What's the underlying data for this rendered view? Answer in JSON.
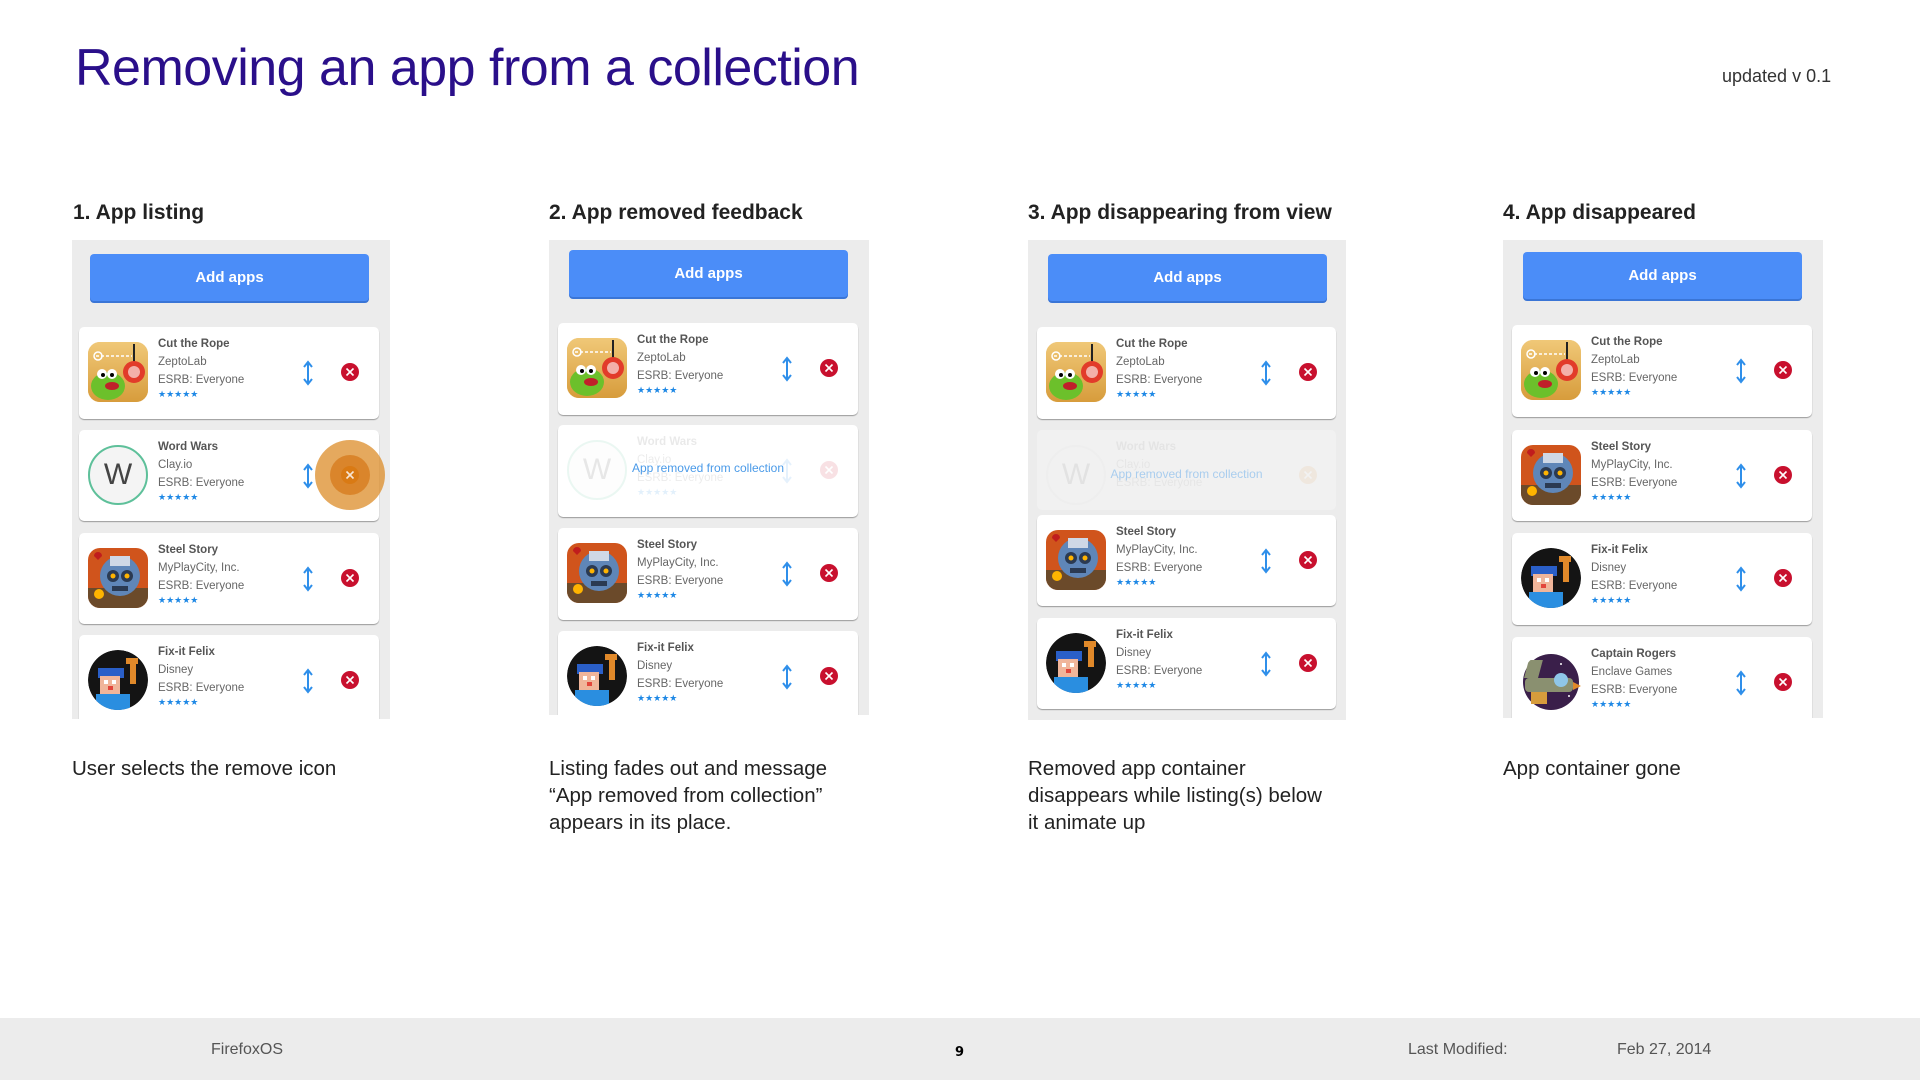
{
  "title": "Removing an app from a collection",
  "version": "updated v 0.1",
  "colors": {
    "title": "#2a0f8a",
    "button": "#4b8df8",
    "remove": "#c8102e",
    "reorder": "#2f8fea",
    "stars": "#1e88e5",
    "panel": "#ececec",
    "touch": "#dc8c28"
  },
  "add_apps_label": "Add apps",
  "removed_message": "App removed from collection",
  "icons": {
    "reorder": "updown-arrow-icon",
    "remove": "close-circle-icon",
    "rating": "star-icon"
  },
  "apps": {
    "cut_the_rope": {
      "name": "Cut the Rope",
      "developer": "ZeptoLab",
      "esrb": "ESRB: Everyone",
      "stars": "★★★★★",
      "rating": 5
    },
    "word_wars": {
      "name": "Word Wars",
      "developer": "Clay.io",
      "esrb": "ESRB: Everyone",
      "stars": "★★★★★",
      "rating": 5,
      "icon_letter": "W"
    },
    "steel_story": {
      "name": "Steel Story",
      "developer": "MyPlayCity, Inc.",
      "esrb": "ESRB: Everyone",
      "stars": "★★★★★",
      "rating": 5
    },
    "fix_it_felix": {
      "name": "Fix-it Felix",
      "developer": "Disney",
      "esrb": "ESRB: Everyone",
      "stars": "★★★★★",
      "rating": 5
    },
    "captain_rogers": {
      "name": "Captain Rogers",
      "developer": "Enclave Games",
      "esrb": "ESRB: Everyone",
      "stars": "★★★★★",
      "rating": 5
    }
  },
  "steps": [
    {
      "heading": "1. App listing",
      "caption": [
        "User selects the remove icon"
      ]
    },
    {
      "heading": "2. App removed feedback",
      "caption": [
        "Listing fades out and message",
        "“App removed from collection”",
        "appears in its place."
      ]
    },
    {
      "heading": "3. App disappearing from view",
      "caption": [
        "Removed app container",
        "disappears while listing(s) below",
        "it animate up"
      ]
    },
    {
      "heading": "4. App disappeared",
      "caption": [
        "App container gone"
      ]
    }
  ],
  "footer": {
    "left": "FirefoxOS",
    "page": "9",
    "modified_label": "Last Modified:",
    "modified_date": "Feb 27, 2014"
  }
}
